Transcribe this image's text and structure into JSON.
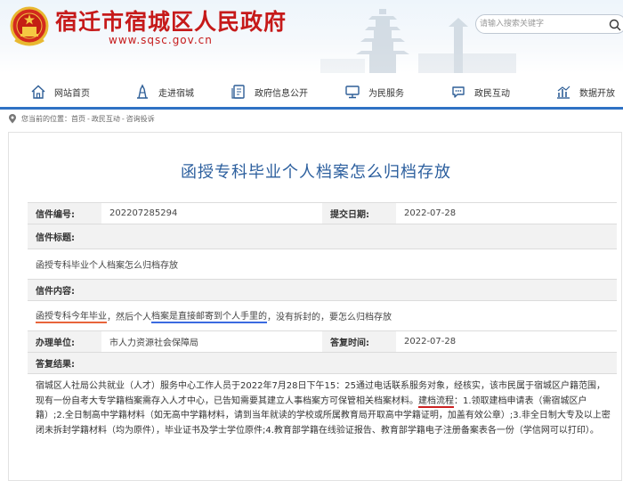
{
  "header": {
    "site_title": "宿迁市宿城区人民政府",
    "site_url": "www.sqsc.gov.cn",
    "search_placeholder": "请输入搜索关键字",
    "brand_color": "#c61a1a"
  },
  "nav": {
    "items": [
      {
        "label": "网站首页",
        "icon": "home-icon"
      },
      {
        "label": "走进宿城",
        "icon": "landmark-icon"
      },
      {
        "label": "政府信息公开",
        "icon": "document-icon"
      },
      {
        "label": "为民服务",
        "icon": "monitor-icon"
      },
      {
        "label": "政民互动",
        "icon": "chat-icon"
      },
      {
        "label": "数据开放",
        "icon": "chart-icon"
      }
    ]
  },
  "breadcrumb": {
    "prefix": "您当前的位置：",
    "items": [
      "首页",
      "政民互动",
      "咨询投诉"
    ],
    "separator": "-"
  },
  "letter": {
    "title": "函授专科毕业个人档案怎么归档存放",
    "number_label": "信件编号:",
    "number_value": "202207285294",
    "submit_date_label": "提交日期:",
    "submit_date_value": "2022-07-28",
    "subject_label": "信件标题:",
    "subject_value": "函授专科毕业个人档案怎么归档存放",
    "content_label": "信件内容:",
    "content_part1": "函授专科今年毕业",
    "content_part2": "，然后个人",
    "content_part3": "档案是直接邮寄到个人手里的",
    "content_part4": "，没有拆封的，要怎么归档存放",
    "dept_label": "办理单位:",
    "dept_value": "市人力资源社会保障局",
    "reply_date_label": "答复时间:",
    "reply_date_value": "2022-07-28",
    "reply_label": "答复结果:",
    "reply_part1": "宿城区人社局公共就业（人才）服务中心工作人员于2022年7月28日下午15：25通过电话联系服务对象，经核实，该市民属于宿城区户籍范围，现有一份自考大专学籍档案需存入人才中心，已告知需要其建立人事档案方可保管相关档案材料。",
    "reply_part2": "建档流程",
    "reply_part3": "：1.领取建档申请表（需宿城区户籍）;2.全日制高中学籍材料（如无高中学籍材料，请到当年就读的学校或所属教育局开取高中学籍证明，加盖有效公章）;3.非全日制大专及以上密闭未拆封学籍材料（均为原件），毕业证书及学士学位原件;4.教育部学籍在线验证报告、教育部学籍电子注册备案表各一份（学信网可以打印）。"
  },
  "colors": {
    "nav_underline": "#2f72c4",
    "title_blue": "#2c5f9e",
    "underline_red": "#e8643a",
    "underline_blue": "#3a6ae0"
  }
}
